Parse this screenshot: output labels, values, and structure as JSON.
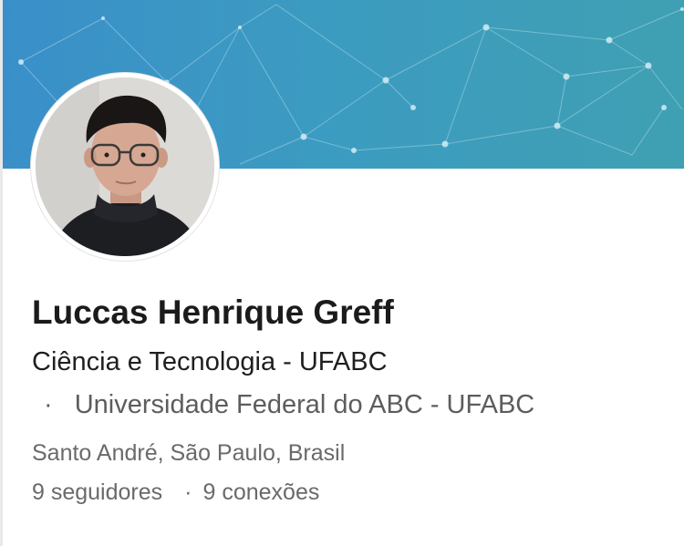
{
  "profile": {
    "name": "Luccas Henrique Greff",
    "headline": "Ciência e Tecnologia - UFABC",
    "education_bullet": "·",
    "education": "Universidade Federal do ABC - UFABC",
    "location": "Santo André, São Paulo, Brasil",
    "followers": "9 seguidores",
    "stats_separator": "·",
    "connections": "9 conexões"
  },
  "colors": {
    "banner_start": "#3a8fc9",
    "banner_end": "#3fa0b3",
    "name_text": "#1b1b1b",
    "secondary_text": "#6a6a6a"
  }
}
